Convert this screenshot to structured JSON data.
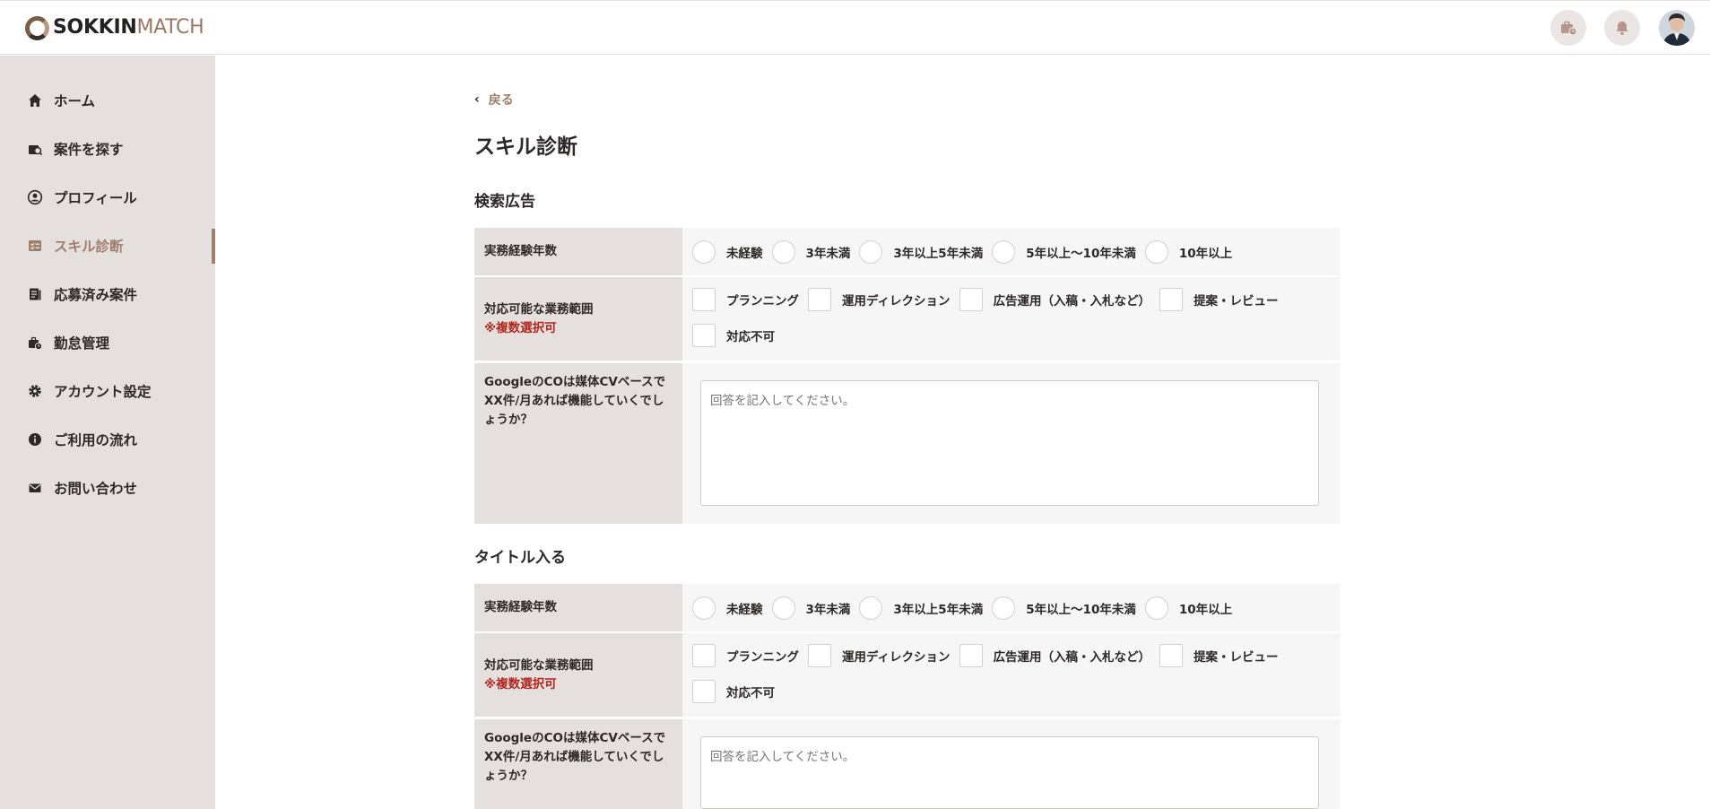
{
  "header": {
    "logo_bold": "SOKKIN",
    "logo_light": "MATCH"
  },
  "sidebar": {
    "items": [
      {
        "label": "ホーム",
        "icon": "home-icon"
      },
      {
        "label": "案件を探す",
        "icon": "search-job-icon"
      },
      {
        "label": "プロフィール",
        "icon": "profile-icon"
      },
      {
        "label": "スキル診断",
        "icon": "skill-icon",
        "active": true
      },
      {
        "label": "応募済み案件",
        "icon": "applied-icon"
      },
      {
        "label": "勤怠管理",
        "icon": "attendance-icon"
      },
      {
        "label": "アカウント設定",
        "icon": "gear-icon"
      },
      {
        "label": "ご利用の流れ",
        "icon": "info-icon"
      },
      {
        "label": "お問い合わせ",
        "icon": "mail-icon"
      }
    ]
  },
  "main": {
    "back_label": "戻る",
    "page_title": "スキル診断",
    "sections": [
      {
        "title": "検索広告",
        "experience_label": "実務経験年数",
        "experience_options": [
          "未経験",
          "3年未満",
          "3年以上5年未満",
          "5年以上〜10年未満",
          "10年以上"
        ],
        "scope_label": "対応可能な業務範囲",
        "scope_note": "※複数選択可",
        "scope_options": [
          "プランニング",
          "運用ディレクション",
          "広告運用（入稿・入札など）",
          "提案・レビュー",
          "対応不可"
        ],
        "question": "GoogleのCOは媒体CVベースでXX件/月あれば機能していくでしょうか？",
        "answer_placeholder": "回答を記入してください。"
      },
      {
        "title": "タイトル入る",
        "experience_label": "実務経験年数",
        "experience_options": [
          "未経験",
          "3年未満",
          "3年以上5年未満",
          "5年以上〜10年未満",
          "10年以上"
        ],
        "scope_label": "対応可能な業務範囲",
        "scope_note": "※複数選択可",
        "scope_options": [
          "プランニング",
          "運用ディレクション",
          "広告運用（入稿・入札など）",
          "提案・レビュー",
          "対応不可"
        ],
        "question": "GoogleのCOは媒体CVベースでXX件/月あれば機能していくでしょうか？",
        "answer_placeholder": "回答を記入してください。"
      }
    ]
  },
  "colors": {
    "accent": "#a07e6b",
    "sidebar_bg": "#e5e0dd",
    "required": "#b3261e"
  }
}
